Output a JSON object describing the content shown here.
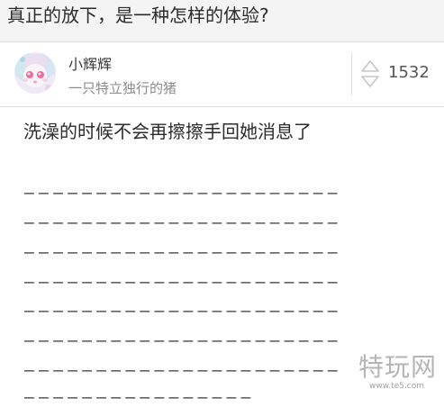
{
  "question": {
    "title": "真正的放下，是一种怎样的体验?"
  },
  "answer": {
    "author": {
      "name": "小辉辉",
      "bio": "一只特立独行的猪",
      "avatar": "anime-girl-avatar"
    },
    "votes": "1532",
    "text": "洗澡的时候不会再擦擦手回她消息了",
    "dash_lines": [
      "——————————————————————",
      "——————————————————————",
      "——————————————————————",
      "——————————————————————",
      "——————————————————————",
      "——————————————————————",
      "——————————————————————",
      "————————————————"
    ]
  },
  "watermark": {
    "brand": "特玩网",
    "url": "www.te5.com"
  },
  "colors": {
    "question_bar_bg": "#f4f4f4",
    "bio_gray": "#8c8c8c"
  }
}
